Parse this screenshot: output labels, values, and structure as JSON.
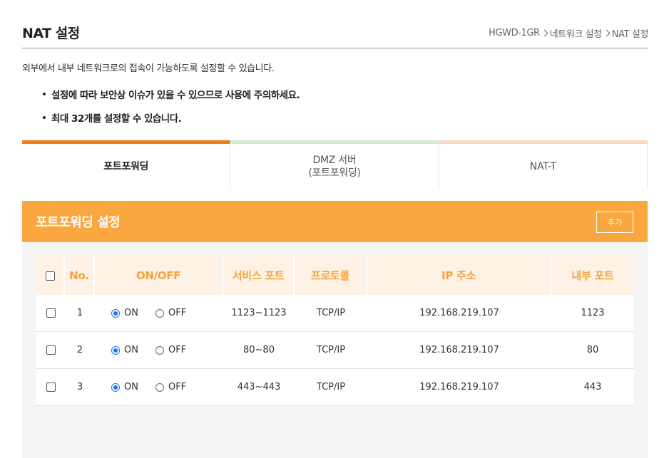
{
  "header": {
    "title": "NAT 설정",
    "breadcrumb": [
      "HGWD-1GR",
      "네트워크 설정",
      "NAT 설정"
    ]
  },
  "description": "외부에서 내부 네트워크로의 접속이 가능하도록 설정할 수 있습니다.",
  "notes": [
    "설정에 따라 보안상 이슈가 있을 수 있으므로 사용에 주의하세요.",
    "최대 32개를 설정할 수 있습니다."
  ],
  "tabs": [
    {
      "label": "포트포워딩",
      "active": true
    },
    {
      "label_line1": "DMZ 서버",
      "label_line2": "(포트포워딩)",
      "active": false
    },
    {
      "label": "NAT-T",
      "active": false
    }
  ],
  "panel": {
    "title": "포트포워딩 설정",
    "add_label": "추가"
  },
  "table": {
    "columns": [
      "No.",
      "ON/OFF",
      "서비스 포트",
      "프로토콜",
      "IP 주소",
      "내부 포트"
    ],
    "on_label": "ON",
    "off_label": "OFF",
    "rows": [
      {
        "no": "1",
        "on": true,
        "service_port": "1123~1123",
        "protocol": "TCP/IP",
        "ip": "192.168.219.107",
        "internal_port": "1123"
      },
      {
        "no": "2",
        "on": true,
        "service_port": "80~80",
        "protocol": "TCP/IP",
        "ip": "192.168.219.107",
        "internal_port": "80"
      },
      {
        "no": "3",
        "on": true,
        "service_port": "443~443",
        "protocol": "TCP/IP",
        "ip": "192.168.219.107",
        "internal_port": "443"
      }
    ]
  },
  "colors": {
    "accent": "#f9a73e",
    "active_tab": "#f07d19",
    "radio": "#1a73e8"
  }
}
